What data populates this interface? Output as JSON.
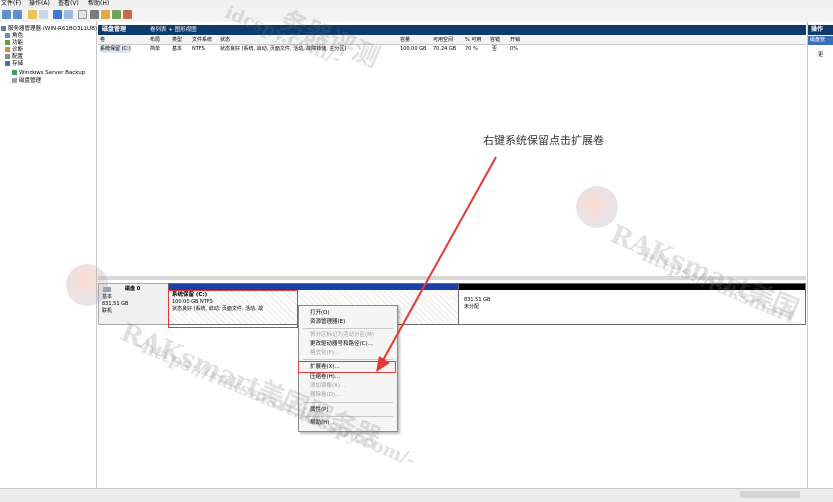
{
  "menubar": [
    "文件(F)",
    "操作(A)",
    "查看(V)",
    "帮助(H)"
  ],
  "tree": [
    {
      "label": "服务器管理器 (WIN-R61BQ3L1UB)",
      "icon": "server-icon"
    },
    {
      "label": "角色",
      "icon": "roles-icon"
    },
    {
      "label": "功能",
      "icon": "features-icon"
    },
    {
      "label": "诊断",
      "icon": "diagnostics-icon"
    },
    {
      "label": "配置",
      "icon": "config-icon"
    },
    {
      "label": "存储",
      "icon": "storage-icon"
    },
    {
      "label": "Windows Server Backup",
      "icon": "backup-icon"
    },
    {
      "label": "磁盘管理",
      "icon": "disk-management-icon"
    }
  ],
  "main": {
    "title": "磁盘管理",
    "view_tabs": "卷列表 + 图形视图"
  },
  "table": {
    "headers": [
      "卷",
      "布局",
      "类型",
      "文件系统",
      "状态",
      "容量",
      "可用空间",
      "% 可用",
      "容错",
      "开销"
    ],
    "row": [
      "系统保留 (C:)",
      "简单",
      "基本",
      "NTFS",
      "状态良好 (系统, 启动, 页面文件, 活动, 故障转储, 主分区)",
      "100.00 GB",
      "70.24 GB",
      "70 %",
      "否",
      "0%"
    ]
  },
  "disk": {
    "name": "磁盘 0",
    "type": "基本",
    "size": "831.51 GB",
    "status": "联机"
  },
  "partitions": {
    "system": {
      "name": "系统保留 (C:)",
      "size": "100.00 GB NTFS",
      "status": "状态良好 (系统, 启动, 页面文件, 活动, 故"
    },
    "free": {
      "size": "831.51 GB",
      "status": "未分配"
    }
  },
  "context_menu": {
    "items": [
      {
        "label": "打开(O)",
        "disabled": false
      },
      {
        "label": "资源管理器(E)",
        "disabled": false
      },
      {
        "label": "将分区标记为活动分区(M)",
        "disabled": true
      },
      {
        "label": "更改驱动器号和路径(C)...",
        "disabled": false
      },
      {
        "label": "格式化(F)...",
        "disabled": true
      },
      {
        "label": "扩展卷(X)...",
        "disabled": false,
        "highlighted": true
      },
      {
        "label": "压缩卷(H)...",
        "disabled": false
      },
      {
        "label": "添加镜像(A)...",
        "disabled": true
      },
      {
        "label": "删除卷(D)...",
        "disabled": true
      },
      {
        "label": "属性(P)",
        "disabled": false
      },
      {
        "label": "帮助(H)",
        "disabled": false
      }
    ]
  },
  "annotation": "右键系统保留点击扩展卷",
  "actions_pane": {
    "title": "操作",
    "subtitle": "磁盘管",
    "more": "更"
  },
  "watermarks": [
    "RAKsmart美国服务器",
    "-https://raksmart.idcspy.com/-",
    "RAKsmart美国",
    "-https://raksmart",
    "idcspy.com/-",
    "务器评测"
  ],
  "colors": {
    "header_blue": "#0b3a6b",
    "primary_partition": "#1d3fa8",
    "annotation_red": "#e53935"
  }
}
